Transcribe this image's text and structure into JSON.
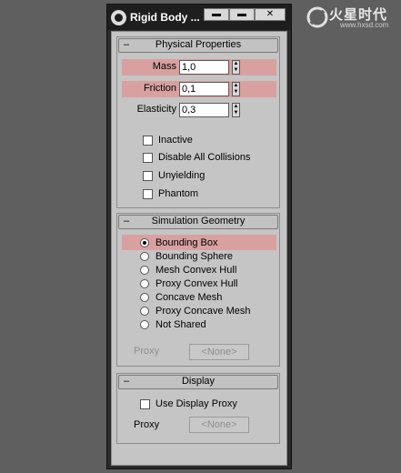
{
  "window": {
    "title": "Rigid Body ...",
    "minimize": "▬",
    "maximize": "▬",
    "close": "✕"
  },
  "watermark": {
    "text": "火星时代",
    "url": "www.hxsd.com"
  },
  "physical": {
    "header": "Physical Properties",
    "collapse": "–",
    "mass_label": "Mass",
    "mass_value": "1,0",
    "friction_label": "Friction",
    "friction_value": "0,1",
    "elasticity_label": "Elasticity",
    "elasticity_value": "0,3",
    "checkboxes": [
      {
        "label": "Inactive",
        "checked": false
      },
      {
        "label": "Disable All Collisions",
        "checked": false
      },
      {
        "label": "Unyielding",
        "checked": false
      },
      {
        "label": "Phantom",
        "checked": false
      }
    ]
  },
  "simulation": {
    "header": "Simulation Geometry",
    "collapse": "–",
    "options": [
      {
        "label": "Bounding Box",
        "selected": true
      },
      {
        "label": "Bounding Sphere",
        "selected": false
      },
      {
        "label": "Mesh Convex Hull",
        "selected": false
      },
      {
        "label": "Proxy Convex Hull",
        "selected": false
      },
      {
        "label": "Concave Mesh",
        "selected": false
      },
      {
        "label": "Proxy Concave Mesh",
        "selected": false
      },
      {
        "label": "Not Shared",
        "selected": false
      }
    ],
    "proxy_label": "Proxy",
    "proxy_button": "<None>"
  },
  "display": {
    "header": "Display",
    "collapse": "–",
    "use_display_proxy_label": "Use Display Proxy",
    "use_display_proxy_checked": false,
    "proxy_label": "Proxy",
    "proxy_button": "<None>"
  },
  "colors": {
    "highlight": "#d9a0a0",
    "panel": "#c5c5c5",
    "background": "#5f5f5f"
  }
}
